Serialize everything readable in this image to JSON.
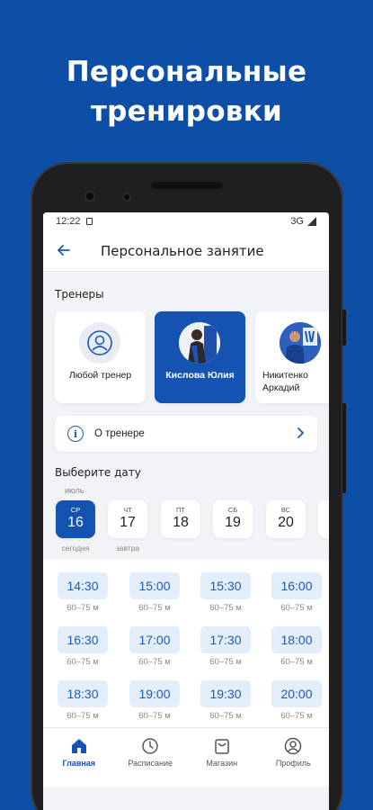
{
  "headline": {
    "line1": "Персональные",
    "line2": "тренировки"
  },
  "status_bar": {
    "time": "12:22",
    "network": "3G"
  },
  "app_bar": {
    "back_icon": "arrow-left-icon",
    "title": "Персональное занятие"
  },
  "trainers_section": {
    "title": "Тренеры",
    "items": [
      {
        "name": "Любой тренер",
        "icon": "user-circle-icon",
        "selected": false
      },
      {
        "name": "Кислова Юлия",
        "icon": "trainer-photo",
        "selected": true
      },
      {
        "name": "Никитенко Аркадий",
        "icon": "trainer-photo",
        "selected": false
      }
    ]
  },
  "about_trainer": {
    "label": "О тренере",
    "icon": "info-icon",
    "chevron": "chevron-right-icon"
  },
  "date_section": {
    "title": "Выберите дату",
    "month": "июль",
    "days": [
      {
        "dow": "ср",
        "num": "16",
        "sub": "сегодня",
        "selected": true
      },
      {
        "dow": "чт",
        "num": "17",
        "sub": "завтра",
        "selected": false
      },
      {
        "dow": "пт",
        "num": "18",
        "sub": "",
        "selected": false
      },
      {
        "dow": "сб",
        "num": "19",
        "sub": "",
        "selected": false
      },
      {
        "dow": "вс",
        "num": "20",
        "sub": "",
        "selected": false
      }
    ]
  },
  "time_slots": [
    {
      "time": "14:30",
      "duration": "60–75 м"
    },
    {
      "time": "15:00",
      "duration": "60–75 м"
    },
    {
      "time": "15:30",
      "duration": "60–75 м"
    },
    {
      "time": "16:00",
      "duration": "60–75 м"
    },
    {
      "time": "16:30",
      "duration": "60–75 м"
    },
    {
      "time": "17:00",
      "duration": "60–75 м"
    },
    {
      "time": "17:30",
      "duration": "60–75 м"
    },
    {
      "time": "18:00",
      "duration": "60–75 м"
    },
    {
      "time": "18:30",
      "duration": "60–75 м"
    },
    {
      "time": "19:00",
      "duration": "60–75 м"
    },
    {
      "time": "19:30",
      "duration": "60–75 м"
    },
    {
      "time": "20:00",
      "duration": "60–75 м"
    }
  ],
  "bottom_nav": [
    {
      "label": "Главная",
      "icon": "home-icon",
      "active": true
    },
    {
      "label": "Расписание",
      "icon": "clock-icon",
      "active": false
    },
    {
      "label": "Магазин",
      "icon": "shopping-bag-icon",
      "active": false
    },
    {
      "label": "Профиль",
      "icon": "profile-icon",
      "active": false
    }
  ],
  "colors": {
    "background": "#0d4ea6",
    "accent": "#1553b0",
    "chip": "#e3eefb"
  }
}
